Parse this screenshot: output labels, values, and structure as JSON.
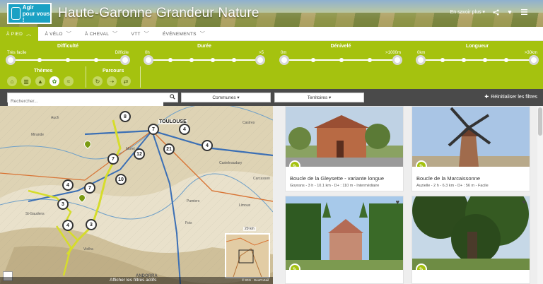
{
  "header": {
    "logo_text_1": "Agir",
    "logo_text_2": "pour vous !",
    "site_title": "Haute-Garonne Grandeur Nature",
    "en_savoir_plus": "En savoir plus ▾",
    "share_icon": "share-icon",
    "heart_icon": "heart-icon",
    "menu_icon": "hamburger-icon"
  },
  "tabs": [
    {
      "label": "À PIED",
      "active": true
    },
    {
      "label": "À VÉLO",
      "active": false
    },
    {
      "label": "À CHEVAL",
      "active": false
    },
    {
      "label": "VTT",
      "active": false
    },
    {
      "label": "ÉVÉNEMENTS",
      "active": false
    }
  ],
  "filters": {
    "difficulte": {
      "title": "Difficulté",
      "min": "Très facile",
      "max": "Difficile"
    },
    "duree": {
      "title": "Durée",
      "min": "0h",
      "max": ">5"
    },
    "denivele": {
      "title": "Dénivelé",
      "min": "0m",
      "max": ">1000m"
    },
    "longueur": {
      "title": "Longueur",
      "min": "0km",
      "max": ">30km"
    },
    "themes": {
      "title": "Thèmes",
      "icons": [
        "theme-heritage-icon",
        "theme-village-icon",
        "theme-mountain-icon",
        "theme-nature-icon",
        "theme-water-icon"
      ]
    },
    "parcours": {
      "title": "Parcours",
      "icons": [
        "loop-icon",
        "one-way-icon",
        "round-trip-icon"
      ]
    }
  },
  "searchbar": {
    "placeholder": "Rechercher...",
    "communes": "Communes ▾",
    "territoires": "Territoires ▾",
    "reset": "Réinitialiser les filtres"
  },
  "map": {
    "city": "TOULOUSE",
    "labels": [
      "Auch",
      "Muret",
      "Castres",
      "Mirande",
      "Carcasson",
      "Limoux",
      "Foix",
      "St-Gaudens",
      "Vielha",
      "ANDORRA",
      "Pamiers",
      "Castelnaudary"
    ],
    "clusters": [
      "8",
      "7",
      "4",
      "12",
      "21",
      "4",
      "7",
      "10",
      "4",
      "7",
      "3",
      "4",
      "3"
    ],
    "show_filters": "Afficher les filtres actifs",
    "credit": "© IGN - GeoPortail",
    "scale": "20 km"
  },
  "results": [
    {
      "title": "Boucle de la Gleysette - variante longue",
      "meta": "Goyrans  -  3 h  -  10.1 km  -  D+ : 110 m  -  Intermédiaire"
    },
    {
      "title": "Boucle de la Marcaissonne",
      "meta": "Auzielle  -  2 h  -  6.3 km  -  D+ : 56 m  -  Facile"
    },
    {
      "title": "",
      "meta": ""
    },
    {
      "title": "",
      "meta": ""
    }
  ],
  "colors": {
    "accent": "#a5c20f",
    "dark_bar": "#4a4a4a",
    "logo_blue": "#1aa1c4"
  }
}
